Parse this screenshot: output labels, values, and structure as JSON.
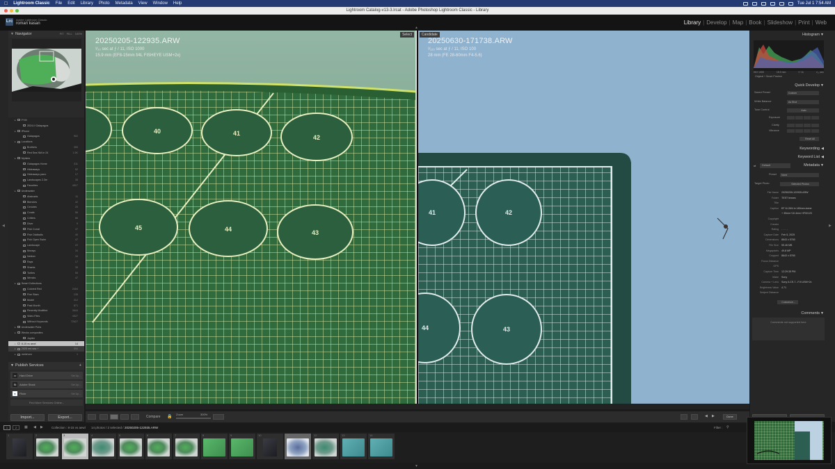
{
  "menubar": {
    "app": "Lightroom Classic",
    "items": [
      "File",
      "Edit",
      "Library",
      "Photo",
      "Metadata",
      "View",
      "Window",
      "Help"
    ],
    "clock": "Tue Jul 1  7:54 AM"
  },
  "window": {
    "title": "Lightroom Catalog-v13-3.lrcat - Adobe Photoshop Lightroom Classic - Library"
  },
  "identity": {
    "logo": "Lrc",
    "product": "Adobe Lightroom Classic",
    "user": "roman kasan"
  },
  "modules": [
    "Library",
    "Develop",
    "Map",
    "Book",
    "Slideshow",
    "Print",
    "Web"
  ],
  "navigator": {
    "title": "Navigator",
    "zoom_options": [
      "FIT",
      "FILL",
      "100%"
    ]
  },
  "collections": [
    {
      "label": "FYM",
      "count": "",
      "indent": 1
    },
    {
      "label": "2024-II Galapagos",
      "count": "",
      "indent": 3
    },
    {
      "label": "iPhone",
      "count": "",
      "indent": 1
    },
    {
      "label": "Galapagos",
      "count": "902",
      "indent": 3
    },
    {
      "label": "Locations",
      "count": "",
      "indent": 1
    },
    {
      "label": "Brothers",
      "count": "355",
      "indent": 3
    },
    {
      "label": "Red Sea NM.In 24",
      "count": "1.5K",
      "indent": 3
    },
    {
      "label": "MyIsles",
      "count": "",
      "indent": 1
    },
    {
      "label": "Galapagos Home",
      "count": "311",
      "indent": 3
    },
    {
      "label": "Hideaways",
      "count": "52",
      "indent": 3
    },
    {
      "label": "Hideaways pano",
      "count": "17",
      "indent": 3
    },
    {
      "label": "Landscapes 2.3m",
      "count": "35",
      "indent": 3
    },
    {
      "label": "Favorites",
      "count": "4517",
      "indent": 3
    },
    {
      "label": "Underwater",
      "count": "",
      "indent": 1
    },
    {
      "label": "Abstracts",
      "count": "11",
      "indent": 3
    },
    {
      "label": "Blennies",
      "count": "42",
      "indent": 3
    },
    {
      "label": "Cenotes",
      "count": "20",
      "indent": 3
    },
    {
      "label": "Corals",
      "count": "56",
      "indent": 3
    },
    {
      "label": "Critters",
      "count": "86",
      "indent": 3
    },
    {
      "label": "Diver",
      "count": "9",
      "indent": 3
    },
    {
      "label": "Fish Corral",
      "count": "47",
      "indent": 3
    },
    {
      "label": "Fish Oddballs",
      "count": "40",
      "indent": 3
    },
    {
      "label": "Fish Open Swim",
      "count": "47",
      "indent": 3
    },
    {
      "label": "Landscape",
      "count": "22",
      "indent": 3
    },
    {
      "label": "Morays",
      "count": "34",
      "indent": 3
    },
    {
      "label": "Nekton",
      "count": "34",
      "indent": 3
    },
    {
      "label": "Rays",
      "count": "17",
      "indent": 3
    },
    {
      "label": "Sharks",
      "count": "35",
      "indent": 3
    },
    {
      "label": "Turtles",
      "count": "55",
      "indent": 3
    },
    {
      "label": "Wrecks",
      "count": "47",
      "indent": 3
    },
    {
      "label": "Smart Collections",
      "count": "",
      "indent": 1
    },
    {
      "label": "Colored Red",
      "count": "2404",
      "indent": 3
    },
    {
      "label": "Five Stars",
      "count": "135",
      "indent": 3
    },
    {
      "label": "Model",
      "count": "312",
      "indent": 3
    },
    {
      "label": "Past Month",
      "count": "871",
      "indent": 3
    },
    {
      "label": "Recently Modified",
      "count": "3644",
      "indent": 3
    },
    {
      "label": "Video Files",
      "count": "4527",
      "indent": 3
    },
    {
      "label": "Without Keywords",
      "count": "72627",
      "indent": 3
    },
    {
      "label": "Underwater Pubs",
      "count": "",
      "indent": 1
    },
    {
      "label": "Wecks composites",
      "count": "",
      "indent": 1
    },
    {
      "label": "Jupiter",
      "count": "",
      "indent": 3
    },
    {
      "label": "8-15 vs aewl",
      "count": "14",
      "indent": 1,
      "selected": true
    },
    {
      "label": "2025 red sea +",
      "count": "556",
      "indent": 1,
      "highlight": true
    },
    {
      "label": "melchuro",
      "count": "1",
      "indent": 1
    }
  ],
  "publish": {
    "title": "Publish Services",
    "services": [
      {
        "badge": "",
        "label": "Hard Drive",
        "action": "Set Up..."
      },
      {
        "badge": "St",
        "label": "Adobe Stock",
        "action": "Set Up..."
      },
      {
        "badge": "",
        "label": "Flickr",
        "action": "Set Up..."
      }
    ],
    "find_more": "Find More Services Online..."
  },
  "left_buttons": {
    "import": "Import...",
    "export": "Export..."
  },
  "compare": {
    "select": {
      "tag": "Select",
      "filename": "20250205-122935.ARW",
      "exposure": "¹⁄₂₀ sec at ƒ / 11, ISO 1000",
      "lens": "15.9 mm (EF8-15mm f/4L FISHEYE USM+2x)",
      "circles": [
        "40",
        "41",
        "42",
        "45",
        "44",
        "43"
      ]
    },
    "candidate": {
      "tag": "Candidate",
      "filename": "20250630-171738.ARW",
      "exposure": "¹⁄₁₂₅ sec at ƒ / 11, ISO 100",
      "lens": "28 mm (FE 28-60mm F4-5.6)",
      "circles": [
        "41",
        "42",
        "44",
        "43"
      ]
    }
  },
  "toolbar": {
    "compare_label": "Compare",
    "zoom_label": "Zoom",
    "zoom_value": "300%",
    "done": "Done"
  },
  "histogram": {
    "title": "Histogram",
    "readout": [
      "ISO 1000",
      "15.9 mm",
      "f / 11",
      "¹⁄₂₀ sec"
    ],
    "preview": "Original + Smart Preview"
  },
  "quick_develop": {
    "title": "Quick Develop",
    "saved_preset_label": "Saved Preset",
    "saved_preset": "Custom",
    "white_balance_label": "White Balance",
    "white_balance": "As Shot",
    "tone_label": "Tone Control",
    "tone_button": "Auto",
    "sliders": [
      "Exposure",
      "Clarity",
      "Vibrance"
    ],
    "reset": "Reset All"
  },
  "keywording_title": "Keywording",
  "keyword_list_title": "Keyword List",
  "metadata": {
    "title": "Metadata",
    "preset_label": "Default",
    "preset_field_label": "Preset",
    "preset_value": "None",
    "target_label": "Target Photo",
    "target_value": "Selected Photos",
    "fields": [
      {
        "k": "File Name",
        "v": "20250205-122935.ARW"
      },
      {
        "k": "Folder",
        "v": "TEST lenses"
      },
      {
        "k": "Title",
        "v": ""
      },
      {
        "k": "Caption",
        "v": "EF 8-15f/4 in 180mm dome"
      },
      {
        "k": "",
        "v": "+ 35mm+10.4mm HFIII/120"
      },
      {
        "k": "Copyright",
        "v": ""
      },
      {
        "k": "Creator",
        "v": ""
      },
      {
        "k": "Rating",
        "v": ". . . . ."
      },
      {
        "k": "Capture Date",
        "v": "Feb 5, 2025"
      },
      {
        "k": "Dimensions",
        "v": "8643 x 5760"
      },
      {
        "k": "File Size",
        "v": "55.46 MB"
      },
      {
        "k": "Megapixels",
        "v": "49.8 MP"
      },
      {
        "k": "Cropped",
        "v": "8643 x 5760"
      },
      {
        "k": "Focus Distance",
        "v": ""
      },
      {
        "k": "GPS",
        "v": ""
      },
      {
        "k": "Capture Time",
        "v": "12:29:35 PM"
      },
      {
        "k": "Make",
        "v": "Sony"
      },
      {
        "k": "Camera + Lens",
        "v": "Sony ILCE-7...F/4 USM+2x"
      },
      {
        "k": "Brightness Value",
        "v": "4.71"
      },
      {
        "k": "Subject Distance",
        "v": ""
      }
    ],
    "customize": "Customize..."
  },
  "comments": {
    "title": "Comments",
    "placeholder": "Comments not supported here"
  },
  "filmstrip_bar": {
    "page1": "1",
    "page2": "2",
    "source": "Collection : 8-15 vs aewl",
    "summary": "14 photos / 2 selected /",
    "current": "20250205-122935.ARW",
    "filter": "Filter :"
  },
  "filmstrip": [
    {
      "n": "1",
      "style": "dark"
    },
    {
      "n": "2",
      "style": "green"
    },
    {
      "n": "3",
      "style": "green",
      "state": "cur"
    },
    {
      "n": "4",
      "style": "teal"
    },
    {
      "n": "5",
      "style": "green"
    },
    {
      "n": "6",
      "style": "green"
    },
    {
      "n": "7",
      "style": "green"
    },
    {
      "n": "8",
      "style": "bright"
    },
    {
      "n": "9",
      "style": "bright"
    },
    {
      "n": "10",
      "style": "dark"
    },
    {
      "n": "11",
      "style": "blue",
      "state": "sel"
    },
    {
      "n": "12",
      "style": "teal"
    },
    {
      "n": "13",
      "style": "cyan"
    },
    {
      "n": "14",
      "style": "cyan"
    }
  ],
  "colors": {
    "grid_bg": "#2f6b3c",
    "grid_line": "#dfe9b0",
    "candidate_bg": "#8fb2cf",
    "candidate_board": "#2f5a4c",
    "selected_row": "#c4c4c4"
  }
}
